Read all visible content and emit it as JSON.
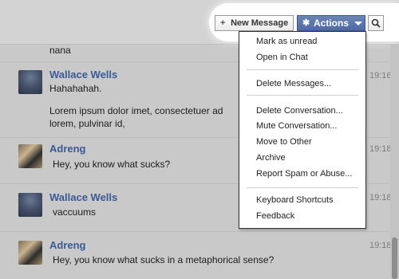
{
  "toolbar": {
    "new_message_label": "New Message",
    "actions_label": "Actions"
  },
  "actions_menu": {
    "groups": [
      [
        "Mark as unread",
        "Open in Chat"
      ],
      [
        "Delete Messages..."
      ],
      [
        "Delete Conversation...",
        "Mute Conversation...",
        "Move to Other",
        "Archive",
        "Report Spam or Abuse..."
      ],
      [
        "Keyboard Shortcuts",
        "Feedback"
      ]
    ]
  },
  "messages": [
    {
      "sender": "",
      "lines": [
        "nana"
      ],
      "time": ""
    },
    {
      "sender": "Wallace Wells",
      "lines": [
        "Hahahahah.",
        "Lorem ipsum dolor imet, consectetuer ad",
        "lorem, pulvinar id,"
      ],
      "time": "19:16"
    },
    {
      "sender": "Adreng",
      "lines": [
        "Hey, you know what sucks?"
      ],
      "time": "19:18"
    },
    {
      "sender": "Wallace Wells",
      "lines": [
        "vaccuums"
      ],
      "time": "19:18"
    },
    {
      "sender": "Adreng",
      "lines": [
        "Hey, you know what sucks in a metaphorical sense?"
      ],
      "time": "19:18"
    }
  ],
  "colors": {
    "accent": "#3b5998",
    "actions_button": "#5b73a8",
    "overlay": "#c9c9c9"
  }
}
